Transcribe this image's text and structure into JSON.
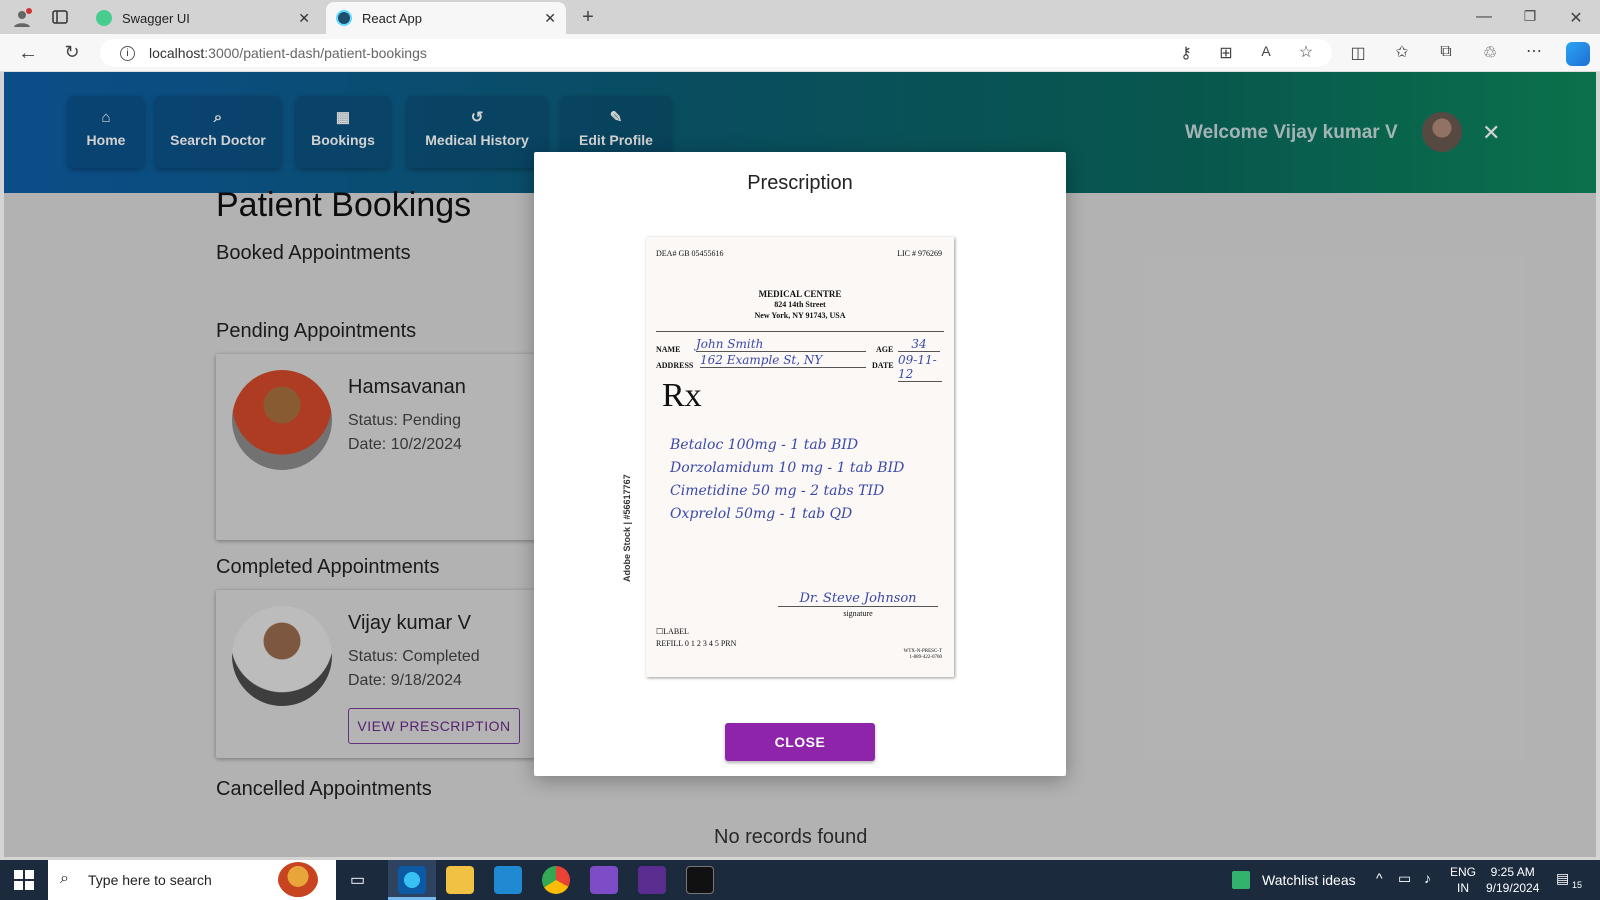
{
  "browser": {
    "tabs": [
      {
        "title": "Swagger UI",
        "color": "#49cc90"
      },
      {
        "title": "React App",
        "color": "#149eca"
      }
    ],
    "url_host": "localhost",
    "url_path": ":3000/patient-dash/patient-bookings"
  },
  "nav": {
    "items": [
      {
        "label": "Home",
        "icon": "home-icon"
      },
      {
        "label": "Search Doctor",
        "icon": "search-icon"
      },
      {
        "label": "Bookings",
        "icon": "calendar-icon"
      },
      {
        "label": "Medical History",
        "icon": "history-icon"
      },
      {
        "label": "Edit Profile",
        "icon": "pencil-icon"
      }
    ],
    "welcome": "Welcome Vijay kumar V"
  },
  "page": {
    "title": "Patient Bookings",
    "booked_heading": "Booked Appointments",
    "pending_heading": "Pending Appointments",
    "completed_heading": "Completed Appointments",
    "cancelled_heading": "Cancelled Appointments",
    "no_records": "No records found"
  },
  "pending": {
    "name": "Hamsavanan",
    "status": "Status: Pending",
    "date": "Date: 10/2/2024"
  },
  "completed": {
    "name": "Vijay kumar V",
    "status": "Status: Completed",
    "date": "Date: 9/18/2024",
    "button": "VIEW PRESCRIPTION"
  },
  "modal": {
    "title": "Prescription",
    "close_label": "CLOSE",
    "prescription": {
      "dea": "DEA# GB 05455616",
      "lic": "LIC # 976269",
      "clinic": "MEDICAL CENTRE",
      "street": "824 14th Street",
      "city": "New York, NY 91743, USA",
      "name_label": "NAME",
      "name_value": "John Smith",
      "age_label": "AGE",
      "age_value": "34",
      "address_label": "ADDRESS",
      "address_value": "162 Example St, NY",
      "date_label": "DATE",
      "date_value": "09-11-12",
      "rx_symbol": "Rx",
      "lines": [
        "Betaloc 100mg - 1 tab BID",
        "Dorzolamidum 10 mg - 1 tab BID",
        "Cimetidine 50 mg - 2 tabs TID",
        "Oxprelol 50mg - 1 tab QD"
      ],
      "signature": "Dr. Steve Johnson",
      "signature_label": "signature",
      "label_box": "LABEL",
      "refill": "REFILL 0 1 2 3 4 5 PRN",
      "code": "WTX-N-PRESC-T",
      "code2": "1-889-422-0700",
      "stock": "Adobe Stock | #56617767"
    }
  },
  "taskbar": {
    "search_placeholder": "Type here to search",
    "widget": "Watchlist ideas",
    "lang1": "ENG",
    "lang2": "IN",
    "time": "9:25 AM",
    "date": "9/19/2024",
    "notif_count": "15"
  }
}
